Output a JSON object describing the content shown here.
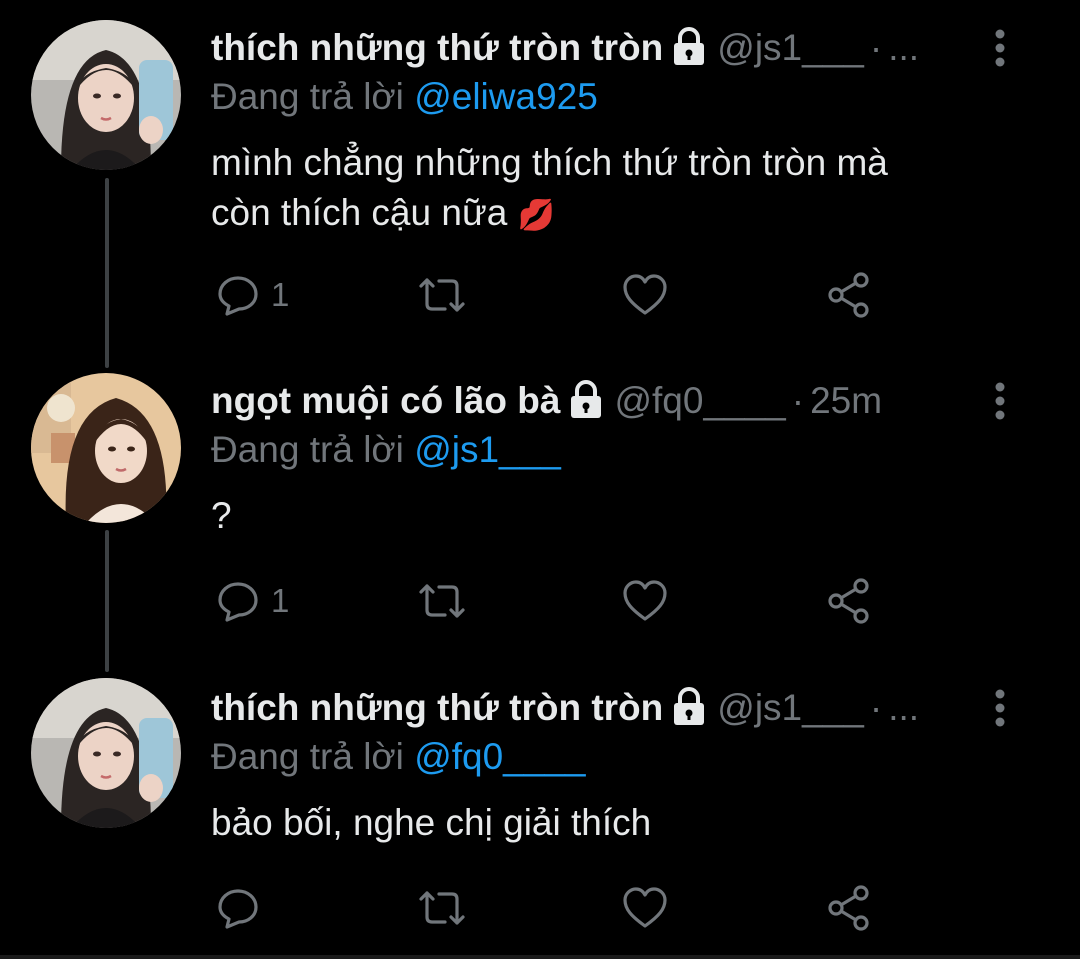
{
  "reply_prefix": "Đang trả lời",
  "tweets": [
    {
      "display_name": "thích những thứ tròn tròn",
      "handle": "@js1___",
      "separator": "·",
      "time": "...",
      "reply_to": "@eliwa925",
      "text_line1": "mình chẳng những thích thứ tròn tròn mà",
      "text_line2": "còn thích cậu nữa",
      "emoji": "💋",
      "reply_count": "1",
      "protected": true
    },
    {
      "display_name": "ngọt muội có lão bà",
      "handle": "@fq0____",
      "separator": "·",
      "time": "25m",
      "reply_to": "@js1___",
      "text_line1": "?",
      "reply_count": "1",
      "protected": true
    },
    {
      "display_name": "thích những thứ tròn tròn",
      "handle": "@js1___",
      "separator": "·",
      "time": "...",
      "reply_to": "@fq0____",
      "text_line1": "bảo bối, nghe chị giải thích",
      "reply_count": "",
      "protected": true
    }
  ],
  "colors": {
    "background": "#000000",
    "text": "#e7e9ea",
    "secondary": "#71767b",
    "accent": "#1d9bf0",
    "thread_line": "#3d4144"
  },
  "icons": {
    "reply": "reply-icon",
    "retweet": "retweet-icon",
    "like": "heart-icon",
    "share": "share-icon",
    "more": "more-vertical-icon",
    "lock": "lock-icon"
  }
}
